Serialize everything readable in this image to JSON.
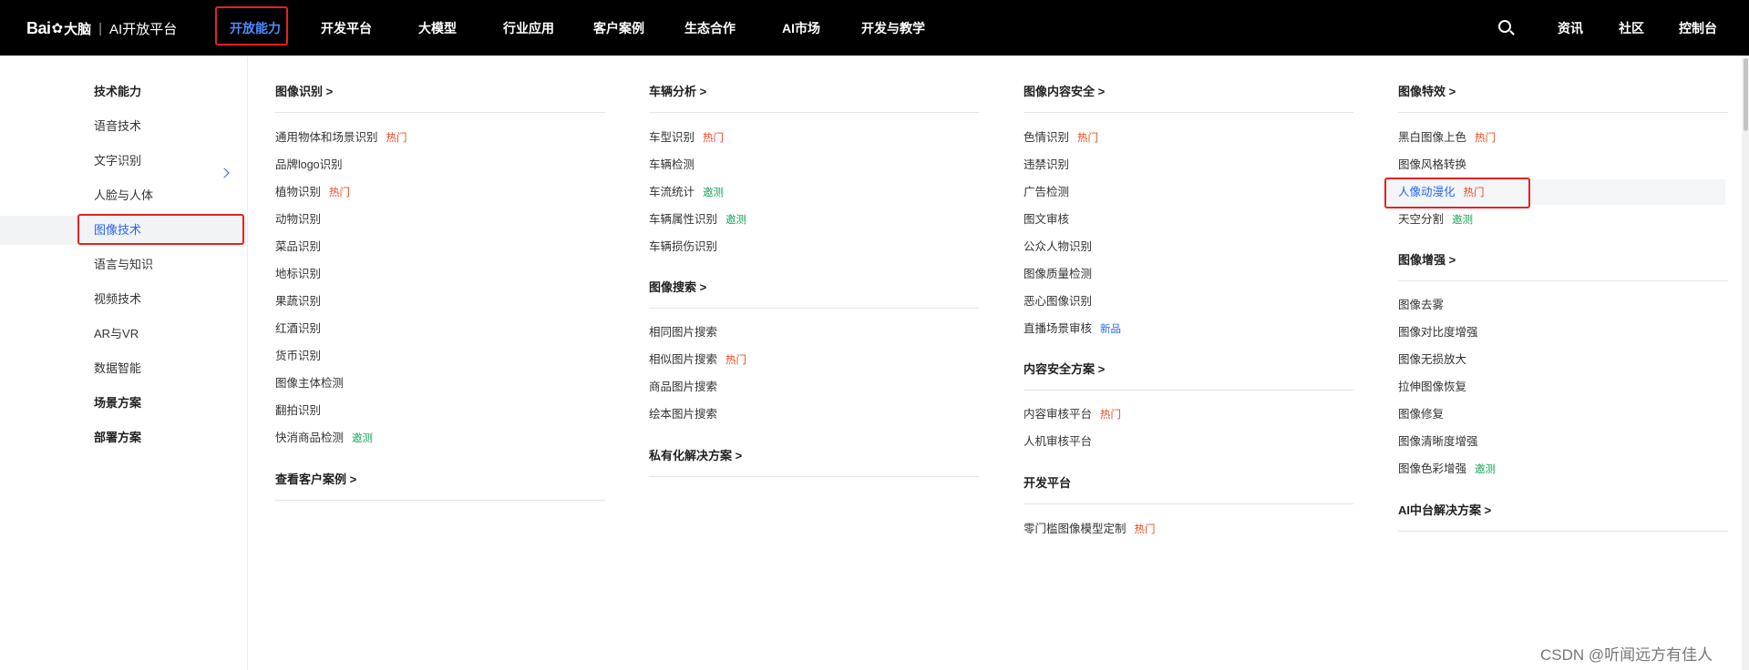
{
  "brand": {
    "bai": "Bai",
    "paw": "✿",
    "du": "大脑",
    "sep": "|",
    "platform": "AI开放平台"
  },
  "nav": {
    "items": [
      "开放能力",
      "开发平台",
      "大模型",
      "行业应用",
      "客户案例",
      "生态合作",
      "AI市场",
      "开发与教学"
    ],
    "right": [
      "资讯",
      "社区",
      "控制台"
    ]
  },
  "sidebar": {
    "items": [
      "技术能力",
      "语音技术",
      "文字识别",
      "人脸与人体",
      "图像技术",
      "语言与知识",
      "视频技术",
      "AR与VR",
      "数据智能",
      "场景方案",
      "部署方案"
    ]
  },
  "tags": {
    "hot": "热门",
    "beta": "邀测",
    "new": "新品"
  },
  "columns": [
    {
      "sections": [
        {
          "title": "图像识别 >",
          "items": [
            {
              "label": "通用物体和场景识别",
              "tag": "hot"
            },
            {
              "label": "品牌logo识别"
            },
            {
              "label": "植物识别",
              "tag": "hot"
            },
            {
              "label": "动物识别"
            },
            {
              "label": "菜品识别"
            },
            {
              "label": "地标识别"
            },
            {
              "label": "果蔬识别"
            },
            {
              "label": "红酒识别"
            },
            {
              "label": "货币识别"
            },
            {
              "label": "图像主体检测"
            },
            {
              "label": "翻拍识别"
            },
            {
              "label": "快消商品检测",
              "tag": "beta"
            }
          ]
        },
        {
          "title": "查看客户案例 >",
          "items": []
        }
      ]
    },
    {
      "sections": [
        {
          "title": "车辆分析 >",
          "items": [
            {
              "label": "车型识别",
              "tag": "hot"
            },
            {
              "label": "车辆检测"
            },
            {
              "label": "车流统计",
              "tag": "beta"
            },
            {
              "label": "车辆属性识别",
              "tag": "beta"
            },
            {
              "label": "车辆损伤识别"
            }
          ]
        },
        {
          "title": "图像搜索 >",
          "items": [
            {
              "label": "相同图片搜索"
            },
            {
              "label": "相似图片搜索",
              "tag": "hot"
            },
            {
              "label": "商品图片搜索"
            },
            {
              "label": "绘本图片搜索"
            }
          ]
        },
        {
          "title": "私有化解决方案 >",
          "items": []
        }
      ]
    },
    {
      "sections": [
        {
          "title": "图像内容安全 >",
          "items": [
            {
              "label": "色情识别",
              "tag": "hot"
            },
            {
              "label": "违禁识别"
            },
            {
              "label": "广告检测"
            },
            {
              "label": "图文审核"
            },
            {
              "label": "公众人物识别"
            },
            {
              "label": "图像质量检测"
            },
            {
              "label": "恶心图像识别"
            },
            {
              "label": "直播场景审核",
              "tag": "new"
            }
          ]
        },
        {
          "title": "内容安全方案 >",
          "items": [
            {
              "label": "内容审核平台",
              "tag": "hot"
            },
            {
              "label": "人机审核平台"
            }
          ]
        },
        {
          "title": "开发平台",
          "items": [
            {
              "label": "零门槛图像模型定制",
              "tag": "hot"
            }
          ]
        }
      ]
    },
    {
      "sections": [
        {
          "title": "图像特效 >",
          "items": [
            {
              "label": "黑白图像上色",
              "tag": "hot"
            },
            {
              "label": "图像风格转换"
            },
            {
              "label": "人像动漫化",
              "tag": "hot"
            },
            {
              "label": "天空分割",
              "tag": "beta"
            }
          ]
        },
        {
          "title": "图像增强 >",
          "items": [
            {
              "label": "图像去雾"
            },
            {
              "label": "图像对比度增强"
            },
            {
              "label": "图像无损放大"
            },
            {
              "label": "拉伸图像恢复"
            },
            {
              "label": "图像修复"
            },
            {
              "label": "图像清晰度增强"
            },
            {
              "label": "图像色彩增强",
              "tag": "beta"
            }
          ]
        },
        {
          "title": "AI中台解决方案 >",
          "items": []
        }
      ]
    }
  ],
  "watermark": "CSDN @听闻远方有佳人",
  "colors": {
    "highlight": "#e8211c",
    "active": "#2468f2",
    "hot": "#f0471e",
    "beta": "#1da55a"
  }
}
